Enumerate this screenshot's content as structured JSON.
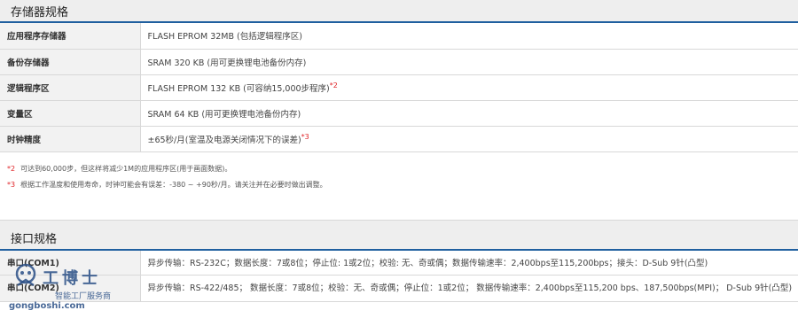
{
  "memory_section": {
    "title": "存储器规格",
    "rows": [
      {
        "label": "应用程序存储器",
        "value": "FLASH EPROM 32MB (包括逻辑程序区)",
        "ref": ""
      },
      {
        "label": "备份存储器",
        "value": "SRAM 320 KB (用可更换锂电池备份内存)",
        "ref": ""
      },
      {
        "label": "逻辑程序区",
        "value": "FLASH EPROM 132 KB (可容纳15,000步程序)",
        "ref": "*2"
      },
      {
        "label": "变量区",
        "value": "SRAM 64 KB (用可更换锂电池备份内存)",
        "ref": ""
      },
      {
        "label": "时钟精度",
        "value": "±65秒/月(室温及电源关闭情况下的误差)",
        "ref": "*3"
      }
    ],
    "notes": [
      {
        "mark": "*2",
        "text": "可达到60,000步，但这样将减少1M的应用程序区(用于画面数据)。"
      },
      {
        "mark": "*3",
        "text": "根据工作温度和使用寿命，时钟可能会有误差：-380 ~ +90秒/月。请关注并在必要时做出调整。"
      }
    ]
  },
  "interface_section": {
    "title": "接口规格",
    "rows": [
      {
        "label": "串口(COM1)",
        "value": "异步传输：RS-232C；数据长度：7或8位；停止位: 1或2位；校验: 无、奇或偶；数据传输速率：2,400bps至115,200bps；接头：D-Sub 9针(凸型)"
      },
      {
        "label": "串口(COM2)",
        "value": "异步传输：RS-422/485；  数据长度：7或8位；校验：无、奇或偶；停止位：1或2位；  数据传输速率：2,400bps至115,200 bps、187,500bps(MPI)；  D-Sub 9针(凸型)"
      }
    ]
  },
  "watermark": {
    "brand": "工博士",
    "subtitle": "智能工厂服务商",
    "url": "gongboshi.com"
  },
  "colors": {
    "accent": "#1f5f9f",
    "ref_red": "#e0262a",
    "header_bg": "#eeeeee",
    "label_bg": "#f2f2f2"
  }
}
